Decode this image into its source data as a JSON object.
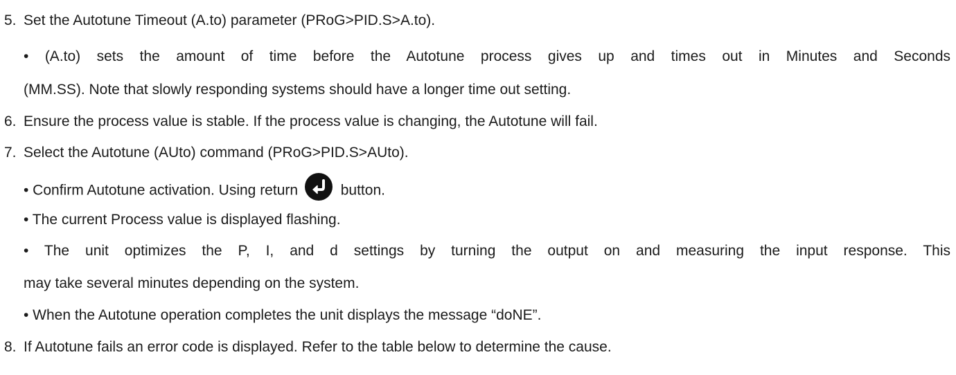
{
  "steps": [
    {
      "number": "5.",
      "text": "Set the Autotune Timeout (A.to) parameter (PRoG>PID.S>A.to).",
      "bullets": [
        {
          "lines": [
            "• (A.to) sets the amount of time before the Autotune process gives up and times out in Minutes and Seconds",
            "(MM.SS). Note that slowly responding systems should have a longer time out setting."
          ]
        }
      ]
    },
    {
      "number": "6.",
      "text": "Ensure the process value is stable. If the process value is changing, the Autotune will fail."
    },
    {
      "number": "7.",
      "text": "Select the Autotune (AUto) command (PRoG>PID.S>AUto).",
      "bullets": [
        {
          "before_icon": "• Confirm Autotune activation. Using return",
          "icon": "return-icon",
          "after_icon": "button."
        },
        {
          "lines": [
            "• The current Process value is displayed flashing."
          ]
        },
        {
          "lines": [
            "• The unit optimizes the P, I, and d settings by turning the output on and measuring the input response. This",
            "may take several minutes depending on the system."
          ]
        },
        {
          "lines": [
            "• When the Autotune operation completes the unit displays the message “doNE”."
          ]
        }
      ]
    },
    {
      "number": "8.",
      "text": "If Autotune fails an error code is displayed. Refer to the table below to determine the cause."
    }
  ]
}
